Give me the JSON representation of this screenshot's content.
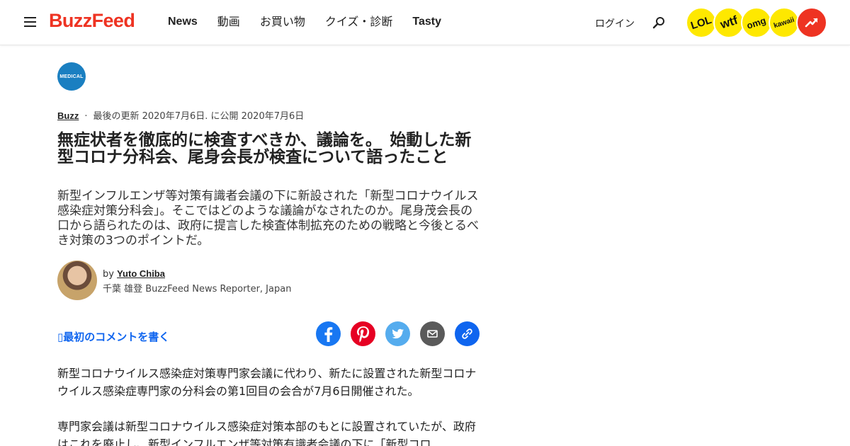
{
  "header": {
    "logo": "BuzzFeed",
    "nav": [
      "News",
      "動画",
      "お買い物",
      "クイズ・診断",
      "Tasty"
    ],
    "login": "ログイン",
    "badges": [
      "LOL",
      "wtf",
      "omg",
      "kawaii"
    ]
  },
  "article": {
    "category_badge": "MEDICAL",
    "section": "Buzz",
    "dates": "最後の更新 2020年7月6日. に公開 2020年7月6日",
    "title": "無症状者を徹底的に検査すべきか、議論を。　始動した新型コロナ分科会、尾身会長が検査について語ったこと",
    "subtitle": "新型インフルエンザ等対策有識者会議の下に新設された「新型コロナウイルス感染症対策分科会」。そこではどのような議論がなされたのか。尾身茂会長の口から語られたのは、政府に提言した検査体制拡充のための戦略と今後とるべき対策の3つのポイントだ。",
    "author": {
      "by": "by",
      "name": "Yuto Chiba",
      "title": "千葉 雄登 BuzzFeed News Reporter, Japan"
    },
    "comment_link": "最初のコメントを書く",
    "paragraphs": [
      "新型コロナウイルス感染症対策専門家会議に代わり、新たに設置された新型コロナウイルス感染症専門家の分科会の第1回目の会合が7月6日開催された。",
      "専門家会議は新型コロナウイルス感染症対策本部のもとに設置されていたが、政府はこれを廃止し、新型インフルエンザ等対策有識者会議の下に「新型コロ"
    ]
  },
  "colors": {
    "brand": "#ee3322",
    "badge_yellow": "#fee800",
    "link_blue": "#0f65ef",
    "medical_blue": "#1a7fc1"
  }
}
